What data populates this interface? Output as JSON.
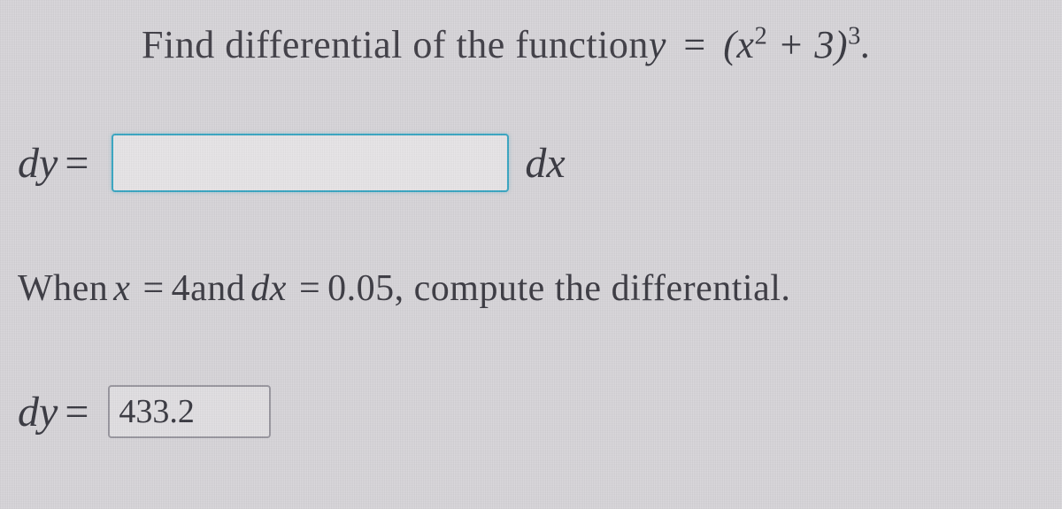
{
  "prompt": {
    "lead": "Find differential of the function ",
    "var": "y",
    "eq": " = ",
    "expr_open": "(",
    "expr_base": "x",
    "expr_sup1": "2",
    "expr_plus": " + 3)",
    "expr_sup2": "3",
    "expr_tail": "."
  },
  "dy_row": {
    "dy": "dy",
    "eq": "= ",
    "input_value": "",
    "dx": "dx"
  },
  "when_row": {
    "lead": "When ",
    "x": "x",
    "eq1": " = ",
    "xval": "4",
    "and": " and ",
    "dx": "dx",
    "eq2": " = ",
    "dxval": "0.05",
    "tail": ", compute the differential."
  },
  "dy2_row": {
    "dy": "dy",
    "eq": "= ",
    "input_value": "433.2"
  }
}
